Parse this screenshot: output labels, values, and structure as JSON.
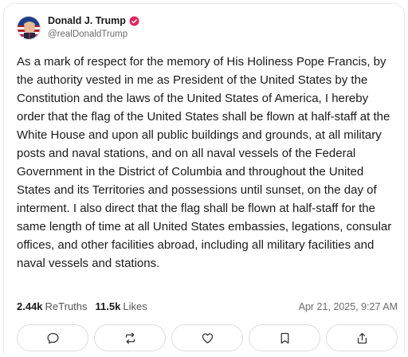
{
  "post": {
    "author": {
      "display_name": "Donald J. Trump",
      "handle": "@realDonaldTrump",
      "verified": true,
      "verified_color": "#e0245e"
    },
    "text": "As a mark of respect for the memory of His Holiness Pope Francis, by the authority vested in me as President of the United States by the Constitution and the laws of the United States of America, I hereby order that the flag of the United States shall be flown at half-staff at the White House and upon all public buildings and grounds, at all military posts and naval stations, and on all naval vessels of the Federal Government in the District of Columbia and throughout the United States and its Territories and possessions until sunset, on the day of interment. I also direct that the flag shall be flown at half-staff for the same length of time at all United States embassies, legations, consular offices, and other facilities abroad, including all military facilities and naval vessels and stations.",
    "stats": {
      "retruths_count": "2.44k",
      "retruths_label": "ReTruths",
      "likes_count": "11.5k",
      "likes_label": "Likes"
    },
    "timestamp": "Apr 21, 2025, 9:27 AM"
  },
  "actions": [
    {
      "name": "reply",
      "icon": "speech-bubble-icon"
    },
    {
      "name": "retruth",
      "icon": "repost-arrows-icon"
    },
    {
      "name": "like",
      "icon": "heart-icon"
    },
    {
      "name": "bookmark",
      "icon": "bookmark-icon"
    },
    {
      "name": "share",
      "icon": "share-upload-icon"
    }
  ]
}
